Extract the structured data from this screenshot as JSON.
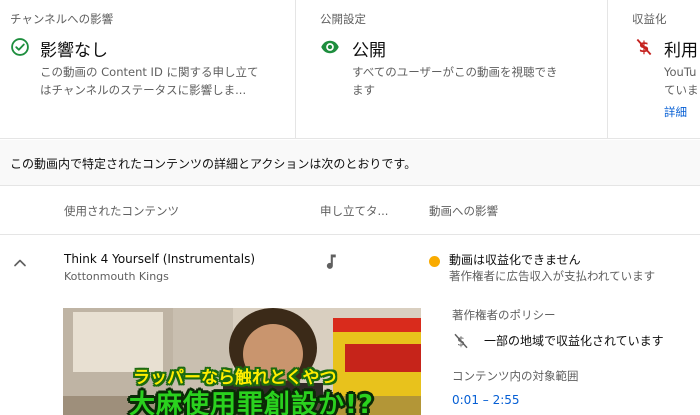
{
  "summary_cards": [
    {
      "title": "チャンネルへの影響",
      "icon": "check-circle-icon",
      "status": "影響なし",
      "description_lines": [
        "この動画の Content ID に関する申し立て",
        "はチャンネルのステータスに影響しま..."
      ]
    },
    {
      "title": "公開設定",
      "icon": "eye-icon",
      "status": "公開",
      "description_lines": [
        "すべてのユーザーがこの動画を視聴でき",
        "ます"
      ]
    },
    {
      "title": "収益化",
      "icon": "no-dollar-icon",
      "status": "利用",
      "description_lines": [
        "YouTu",
        "ていま"
      ],
      "link": "詳細"
    }
  ],
  "intro_text": "この動画内で特定されたコンテンツの詳細とアクションは次のとおりです。",
  "table": {
    "headers": {
      "content": "使用されたコンテンツ",
      "claim": "申し立てタ...",
      "impact": "動画への影響"
    },
    "rows": [
      {
        "title": "Think 4 Yourself (Instrumentals)",
        "artist": "Kottonmouth Kings",
        "claim_type_icon": "music-note-icon",
        "impact_main": "動画は収益化できません",
        "impact_sub": "著作権者に広告収入が支払われています",
        "thumbnail_caption_1": "ラッパーなら触れとくやつ",
        "thumbnail_caption_2": "大麻使用罪創設か!?",
        "policy_label": "著作権者のポリシー",
        "policy_icon": "no-dollar-icon",
        "policy_text": "一部の地域で収益化されています",
        "range_label": "コンテンツ内の対象範囲",
        "range_value": "0:01 – 2:55"
      }
    ]
  },
  "colors": {
    "accent_blue": "#065fd4",
    "check_green": "#1e8e3e",
    "warning_yellow": "#f9ab00",
    "demonetized_red": "#c5221f"
  }
}
